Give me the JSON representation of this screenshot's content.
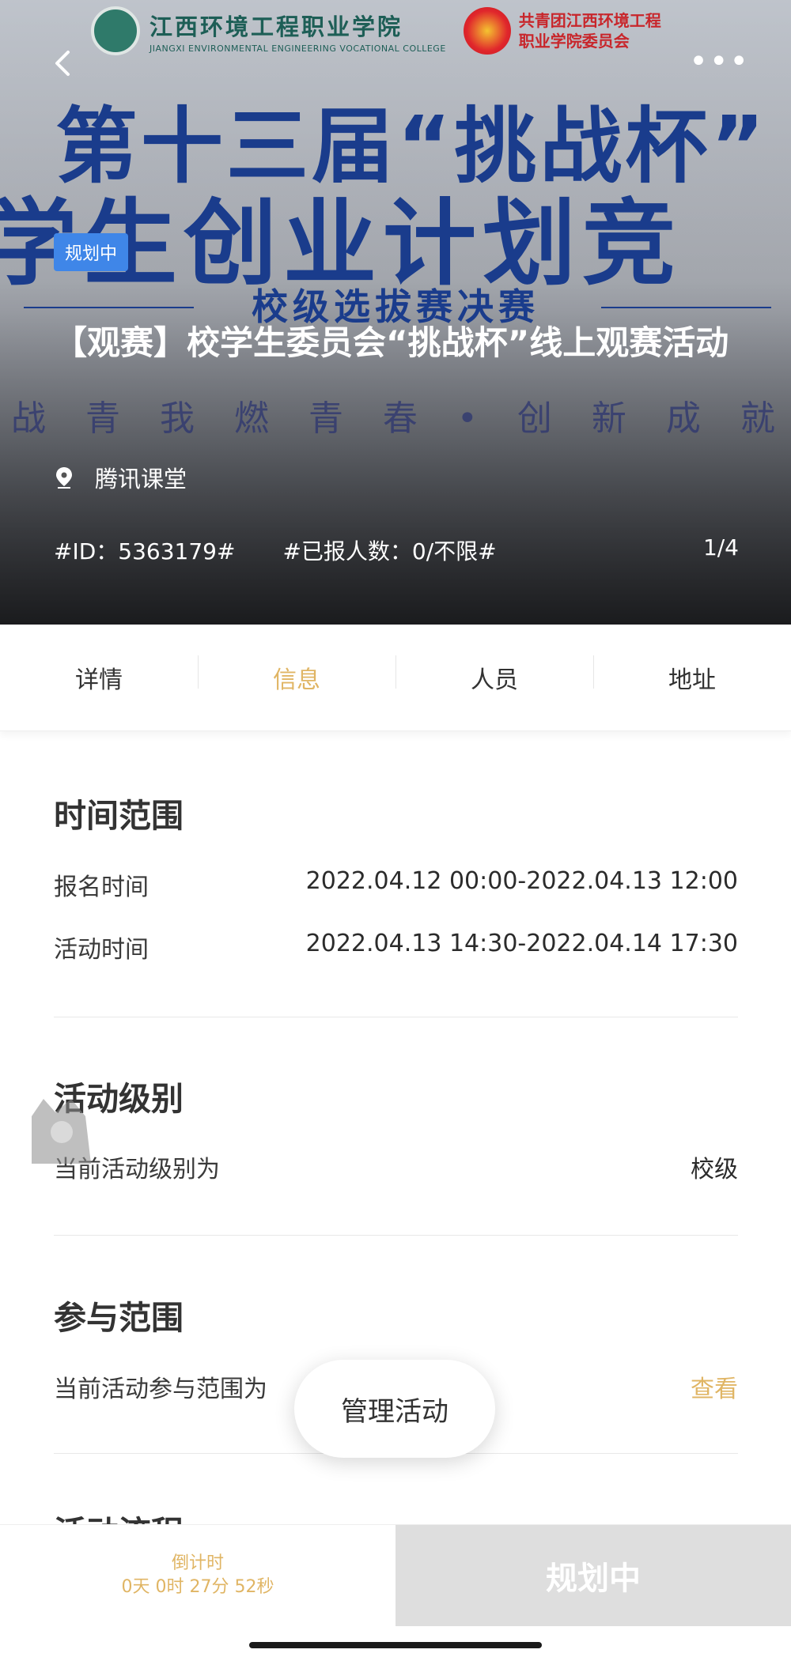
{
  "header": {
    "college_name_cn": "江西环境工程职业学院",
    "college_name_en": "JIANGXI ENVIRONMENTAL ENGINEERING VOCATIONAL COLLEGE",
    "league_name_line1": "共青团江西环境工程",
    "league_name_line2": "职业学院委员会",
    "poster_line1": "第十三届“挑战杯”",
    "poster_line2": "学生创业计划竞",
    "poster_line3": "校级选拔赛决赛",
    "poster_slogan": "战 青 我 燃 青 春  •  创 新 成 就 中 国"
  },
  "event": {
    "status_tag": "规划中",
    "title": "【观赛】校学生委员会“挑战杯”线上观赛活动",
    "location": "腾讯课堂",
    "id_text": "#ID：5363179#",
    "registered_text": "#已报人数：0/不限#",
    "page_indicator": "1/4"
  },
  "tabs": [
    {
      "label": "详情"
    },
    {
      "label": "信息"
    },
    {
      "label": "人员"
    },
    {
      "label": "地址"
    }
  ],
  "active_tab": "信息",
  "time_range": {
    "title": "时间范围",
    "signup_label": "报名时间",
    "signup_value": "2022.04.12 00:00-2022.04.13 12:00",
    "activity_label": "活动时间",
    "activity_value": "2022.04.13 14:30-2022.04.14 17:30"
  },
  "level": {
    "title": "活动级别",
    "label": "当前活动级别为",
    "value": "校级"
  },
  "scope": {
    "title": "参与范围",
    "label": "当前活动参与范围为",
    "link": "查看"
  },
  "next_section_title": "活动流程",
  "fab_label": "管理活动",
  "bottom": {
    "countdown_label": "倒计时",
    "countdown_value": "0天 0时 27分 52秒",
    "status_button": "规划中"
  },
  "colors": {
    "accent": "#e0b564",
    "tag_blue": "#3f86e8",
    "poster_blue": "#1a3c8c",
    "disabled_gray": "#dedede"
  }
}
